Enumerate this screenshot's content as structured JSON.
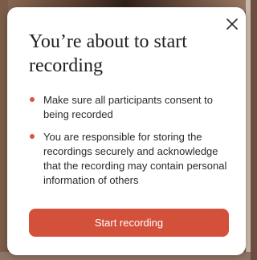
{
  "colors": {
    "accent": "#d3513b",
    "bullet_dot": "#e0533b",
    "title_text": "#1f1f1f",
    "body_text": "#2a2a2a",
    "modal_bg": "#ffffff"
  },
  "modal": {
    "close_icon": "close-icon",
    "title": "You’re about to start recording",
    "bullets": [
      {
        "text": "Make sure all participants consent to being recorded"
      },
      {
        "text": "You are responsible for storing the recordings securely and acknowledge that the recording may contain personal information of others"
      }
    ],
    "primary_button_label": "Start recording"
  }
}
